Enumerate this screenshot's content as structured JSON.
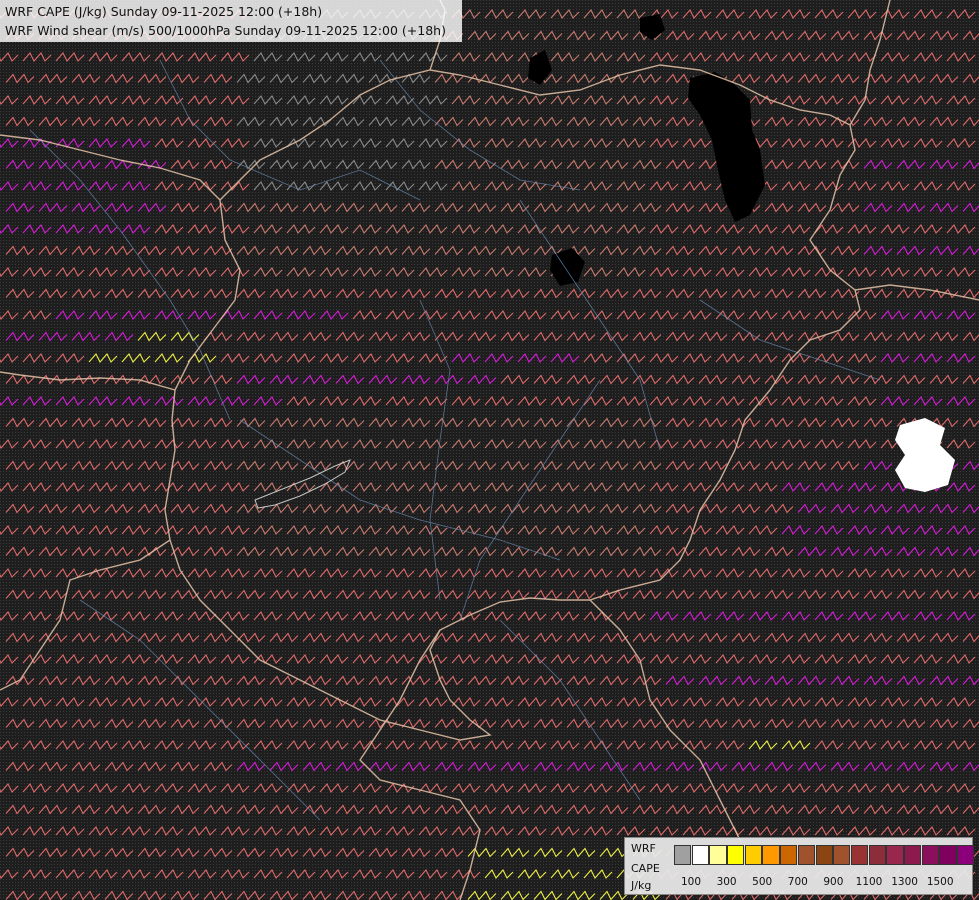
{
  "header": {
    "line1": "WRF CAPE (J/kg) Sunday 09-11-2025 12:00 (+18h)",
    "line2": "WRF Wind shear (m/s) 500/1000hPa Sunday 09-11-2025 12:00 (+18h)"
  },
  "legend": {
    "title_line1": "WRF",
    "title_line2": "CAPE",
    "units": "J/kg",
    "swatch_colors": [
      "#a0a0a0",
      "#ffffff",
      "#ffff99",
      "#ffff00",
      "#ffcc00",
      "#ff9900",
      "#cc6600",
      "#a0522d",
      "#8b4513",
      "#a0522d",
      "#993333",
      "#8b2d3a",
      "#99264d",
      "#8c1a4d",
      "#8b0f5a",
      "#800060",
      "#8b007a"
    ],
    "tick_labels": [
      "100",
      "300",
      "500",
      "700",
      "900",
      "1100",
      "1300",
      "1500"
    ]
  },
  "colors": {
    "background": "#1e1e1e",
    "border_line": "#e6c3a8",
    "county_line": "#6b8fb8",
    "barb_low": "#8a8a8a",
    "barb_mid": "#c87a6e",
    "barb_high": "#e06a6a",
    "barb_very_high": "#d61cd6",
    "barb_extreme": "#eeee44",
    "cape_white": "#ffffff",
    "cape_black": "#000000"
  }
}
